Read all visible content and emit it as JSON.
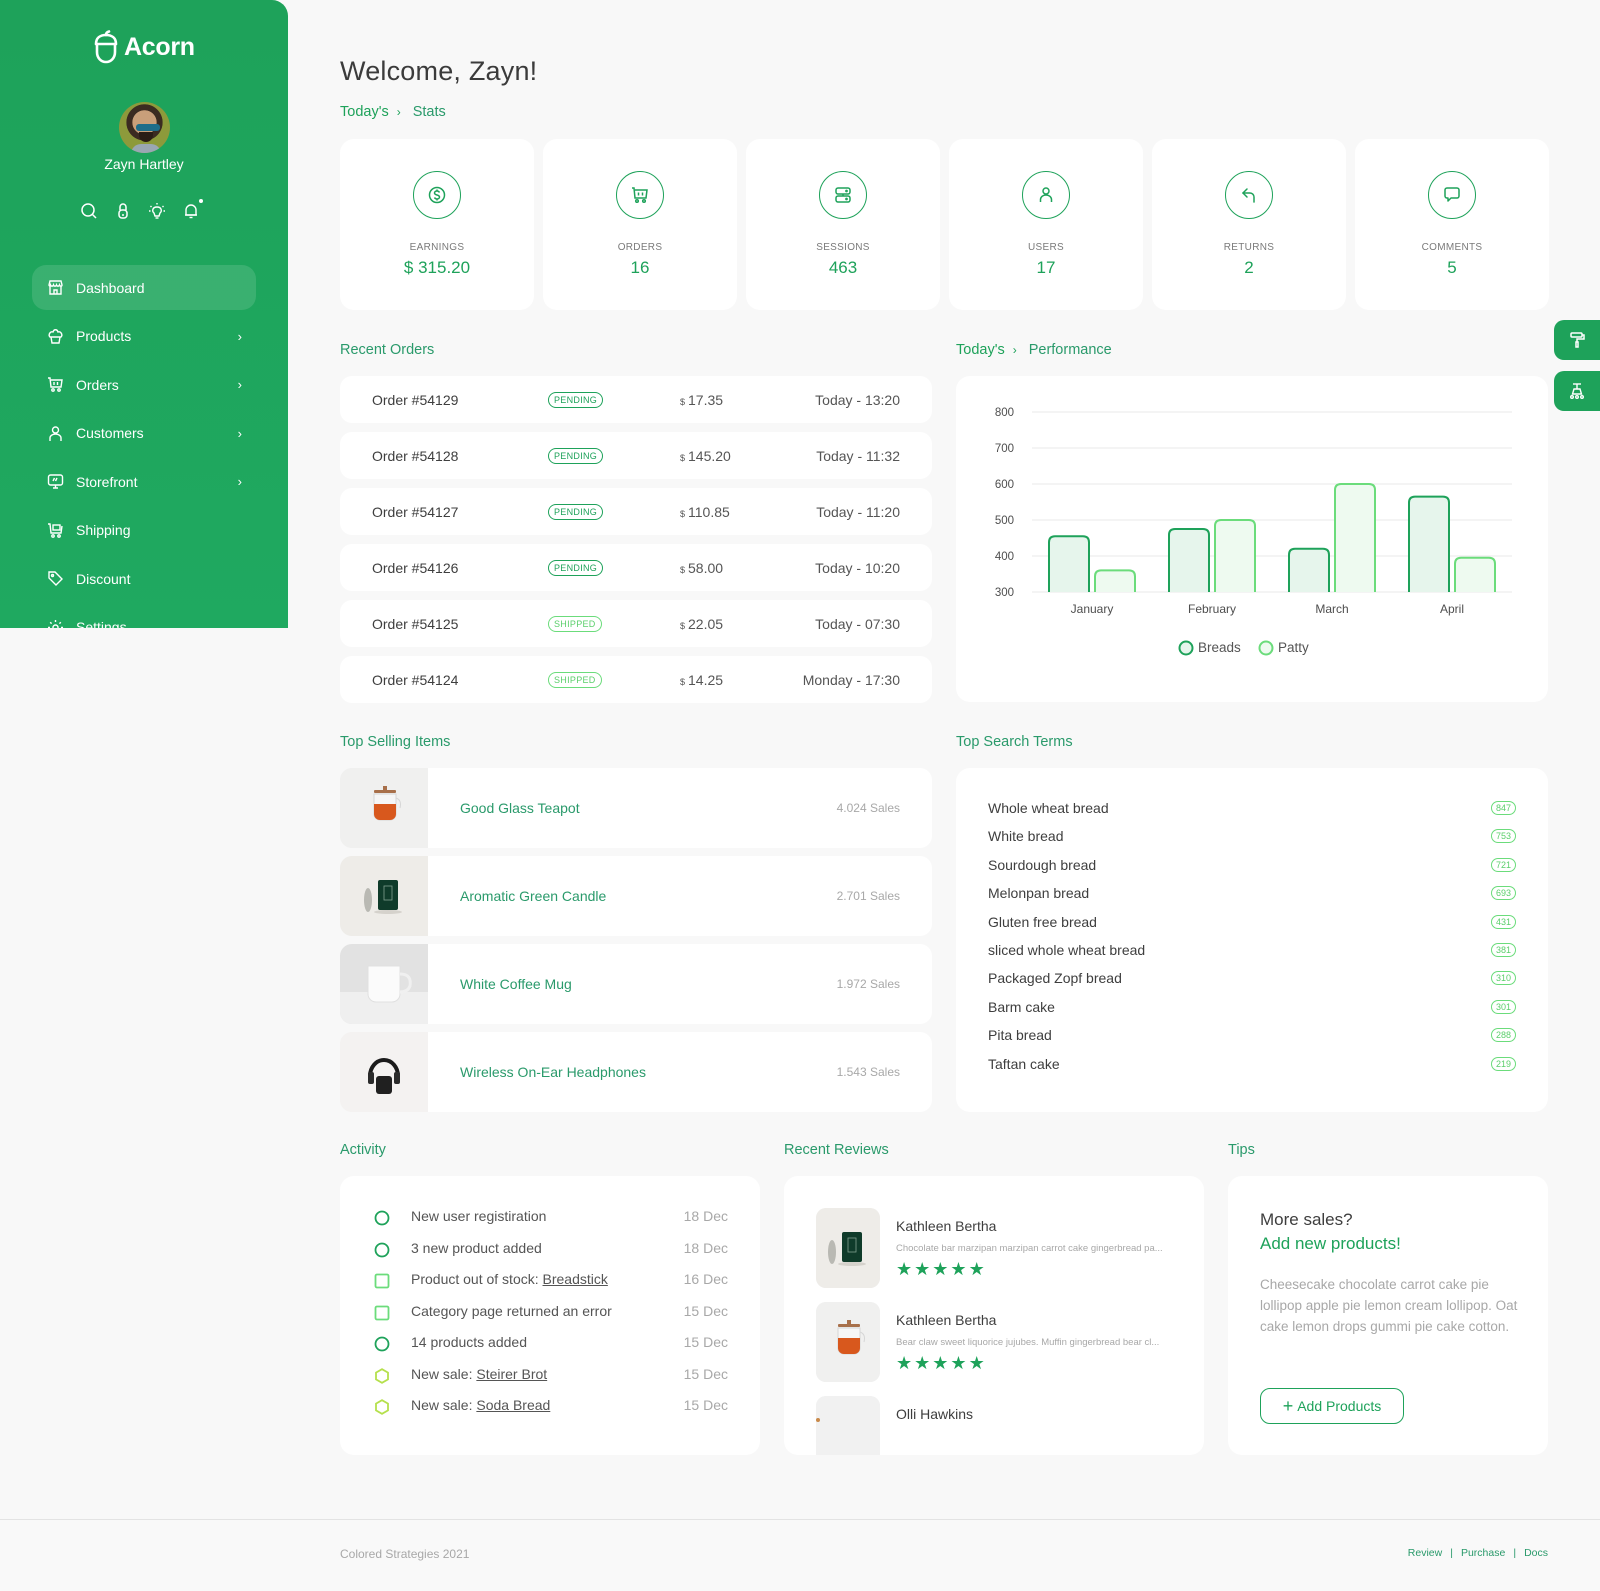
{
  "app": {
    "name": "Acorn"
  },
  "user": {
    "name": "Zayn Hartley"
  },
  "quick_icons": [
    "search-icon",
    "lock-icon",
    "lightbulb-icon",
    "bell-icon"
  ],
  "sidebar": {
    "items": [
      {
        "label": "Dashboard",
        "icon": "store-icon",
        "active": true,
        "has_children": false
      },
      {
        "label": "Products",
        "icon": "cupcake-icon",
        "active": false,
        "has_children": true
      },
      {
        "label": "Orders",
        "icon": "cart-icon",
        "active": false,
        "has_children": true
      },
      {
        "label": "Customers",
        "icon": "user-icon",
        "active": false,
        "has_children": true
      },
      {
        "label": "Storefront",
        "icon": "monitor-icon",
        "active": false,
        "has_children": true
      },
      {
        "label": "Shipping",
        "icon": "shipping-cart-icon",
        "active": false,
        "has_children": false
      },
      {
        "label": "Discount",
        "icon": "tag-icon",
        "active": false,
        "has_children": false
      },
      {
        "label": "Settings",
        "icon": "gear-icon",
        "active": false,
        "has_children": false
      }
    ]
  },
  "header": {
    "welcome": "Welcome, Zayn!",
    "breadcrumb": {
      "first": "Today's",
      "second": "Stats"
    }
  },
  "stats": [
    {
      "label": "EARNINGS",
      "value": "$ 315.20",
      "icon": "dollar-icon"
    },
    {
      "label": "ORDERS",
      "value": "16",
      "icon": "cart-icon"
    },
    {
      "label": "SESSIONS",
      "value": "463",
      "icon": "server-icon"
    },
    {
      "label": "USERS",
      "value": "17",
      "icon": "user-icon"
    },
    {
      "label": "RETURNS",
      "value": "2",
      "icon": "return-arrow-icon"
    },
    {
      "label": "COMMENTS",
      "value": "5",
      "icon": "comment-icon"
    }
  ],
  "recent_orders": {
    "title": "Recent Orders",
    "currency_symbol": "$",
    "rows": [
      {
        "id": "Order #54129",
        "status": "PENDING",
        "amount": "17.35",
        "time": "Today - 13:20"
      },
      {
        "id": "Order #54128",
        "status": "PENDING",
        "amount": "145.20",
        "time": "Today - 11:32"
      },
      {
        "id": "Order #54127",
        "status": "PENDING",
        "amount": "110.85",
        "time": "Today - 11:20"
      },
      {
        "id": "Order #54126",
        "status": "PENDING",
        "amount": "58.00",
        "time": "Today - 10:20"
      },
      {
        "id": "Order #54125",
        "status": "SHIPPED",
        "amount": "22.05",
        "time": "Today - 07:30"
      },
      {
        "id": "Order #54124",
        "status": "SHIPPED",
        "amount": "14.25",
        "time": "Monday - 17:30"
      }
    ]
  },
  "performance": {
    "breadcrumb": {
      "first": "Today's",
      "second": "Performance"
    }
  },
  "chart_data": {
    "type": "bar",
    "title": "Performance",
    "categories": [
      "January",
      "February",
      "March",
      "April"
    ],
    "series": [
      {
        "name": "Breads",
        "values": [
          455,
          475,
          420,
          565
        ],
        "color": "#1ea25a"
      },
      {
        "name": "Patty",
        "values": [
          360,
          500,
          600,
          395
        ],
        "color": "#6bdc7b"
      }
    ],
    "yticks": [
      300,
      400,
      500,
      600,
      700,
      800
    ],
    "ylim": [
      300,
      800
    ],
    "xlabel": "",
    "ylabel": "",
    "grid": true,
    "legend": "bottom-center"
  },
  "top_selling": {
    "title": "Top Selling Items",
    "items": [
      {
        "name": "Good Glass Teapot",
        "sales": "4.024 Sales",
        "image": "teapot"
      },
      {
        "name": "Aromatic Green Candle",
        "sales": "2.701 Sales",
        "image": "candle"
      },
      {
        "name": "White Coffee Mug",
        "sales": "1.972 Sales",
        "image": "mug"
      },
      {
        "name": "Wireless On-Ear Headphones",
        "sales": "1.543 Sales",
        "image": "headphones"
      }
    ]
  },
  "top_search": {
    "title": "Top Search Terms",
    "terms": [
      {
        "term": "Whole wheat bread",
        "count": "847"
      },
      {
        "term": "White bread",
        "count": "753"
      },
      {
        "term": "Sourdough bread",
        "count": "721"
      },
      {
        "term": "Melonpan bread",
        "count": "693"
      },
      {
        "term": "Gluten free bread",
        "count": "431"
      },
      {
        "term": "sliced whole wheat bread",
        "count": "381"
      },
      {
        "term": "Packaged Zopf bread",
        "count": "310"
      },
      {
        "term": "Barm cake",
        "count": "301"
      },
      {
        "term": "Pita bread",
        "count": "288"
      },
      {
        "term": "Taftan cake",
        "count": "219"
      }
    ]
  },
  "activity": {
    "title": "Activity",
    "items": [
      {
        "text": "New user registiration",
        "link": "",
        "date": "18 Dec",
        "icon": "circle",
        "color": "#1ea25a"
      },
      {
        "text": "3 new product added",
        "link": "",
        "date": "18 Dec",
        "icon": "circle",
        "color": "#1ea25a"
      },
      {
        "text": "Product out of stock: ",
        "link": "Breadstick",
        "date": "16 Dec",
        "icon": "square",
        "color": "#6bdc7b"
      },
      {
        "text": "Category page returned an error",
        "link": "",
        "date": "15 Dec",
        "icon": "square",
        "color": "#6bdc7b"
      },
      {
        "text": "14 products added",
        "link": "",
        "date": "15 Dec",
        "icon": "circle",
        "color": "#1ea25a"
      },
      {
        "text": "New sale: ",
        "link": "Steirer Brot",
        "date": "15 Dec",
        "icon": "hexagon",
        "color": "#b5e04c"
      },
      {
        "text": "New sale: ",
        "link": "Soda Bread",
        "date": "15 Dec",
        "icon": "hexagon",
        "color": "#b5e04c"
      }
    ]
  },
  "reviews": {
    "title": "Recent Reviews",
    "items": [
      {
        "name": "Kathleen Bertha",
        "text": "Chocolate bar marzipan marzipan carrot cake gingerbread pa...",
        "rating": 5,
        "image": "candle"
      },
      {
        "name": "Kathleen Bertha",
        "text": "Bear claw sweet liquorice jujubes. Muffin gingerbread bear cl...",
        "rating": 5,
        "image": "teapot"
      },
      {
        "name": "Olli Hawkins",
        "text": "",
        "rating": null,
        "image": "other"
      }
    ]
  },
  "tips": {
    "title": "Tips",
    "question": "More sales?",
    "headline": "Add new products!",
    "body": "Cheesecake chocolate carrot cake pie lollipop apple pie lemon cream lollipop. Oat cake lemon drops gummi pie cake cotton.",
    "button_label": "Add Products"
  },
  "footer": {
    "copyright": "Colored Strategies 2021",
    "links": [
      "Review",
      "Purchase",
      "Docs"
    ]
  },
  "floating_buttons": [
    "paint-roller-icon",
    "layout-icon"
  ],
  "colors": {
    "primary": "#1ea25a",
    "secondary": "#6bdc7b",
    "tertiary": "#b5e04c",
    "background": "#f8f8f8"
  }
}
